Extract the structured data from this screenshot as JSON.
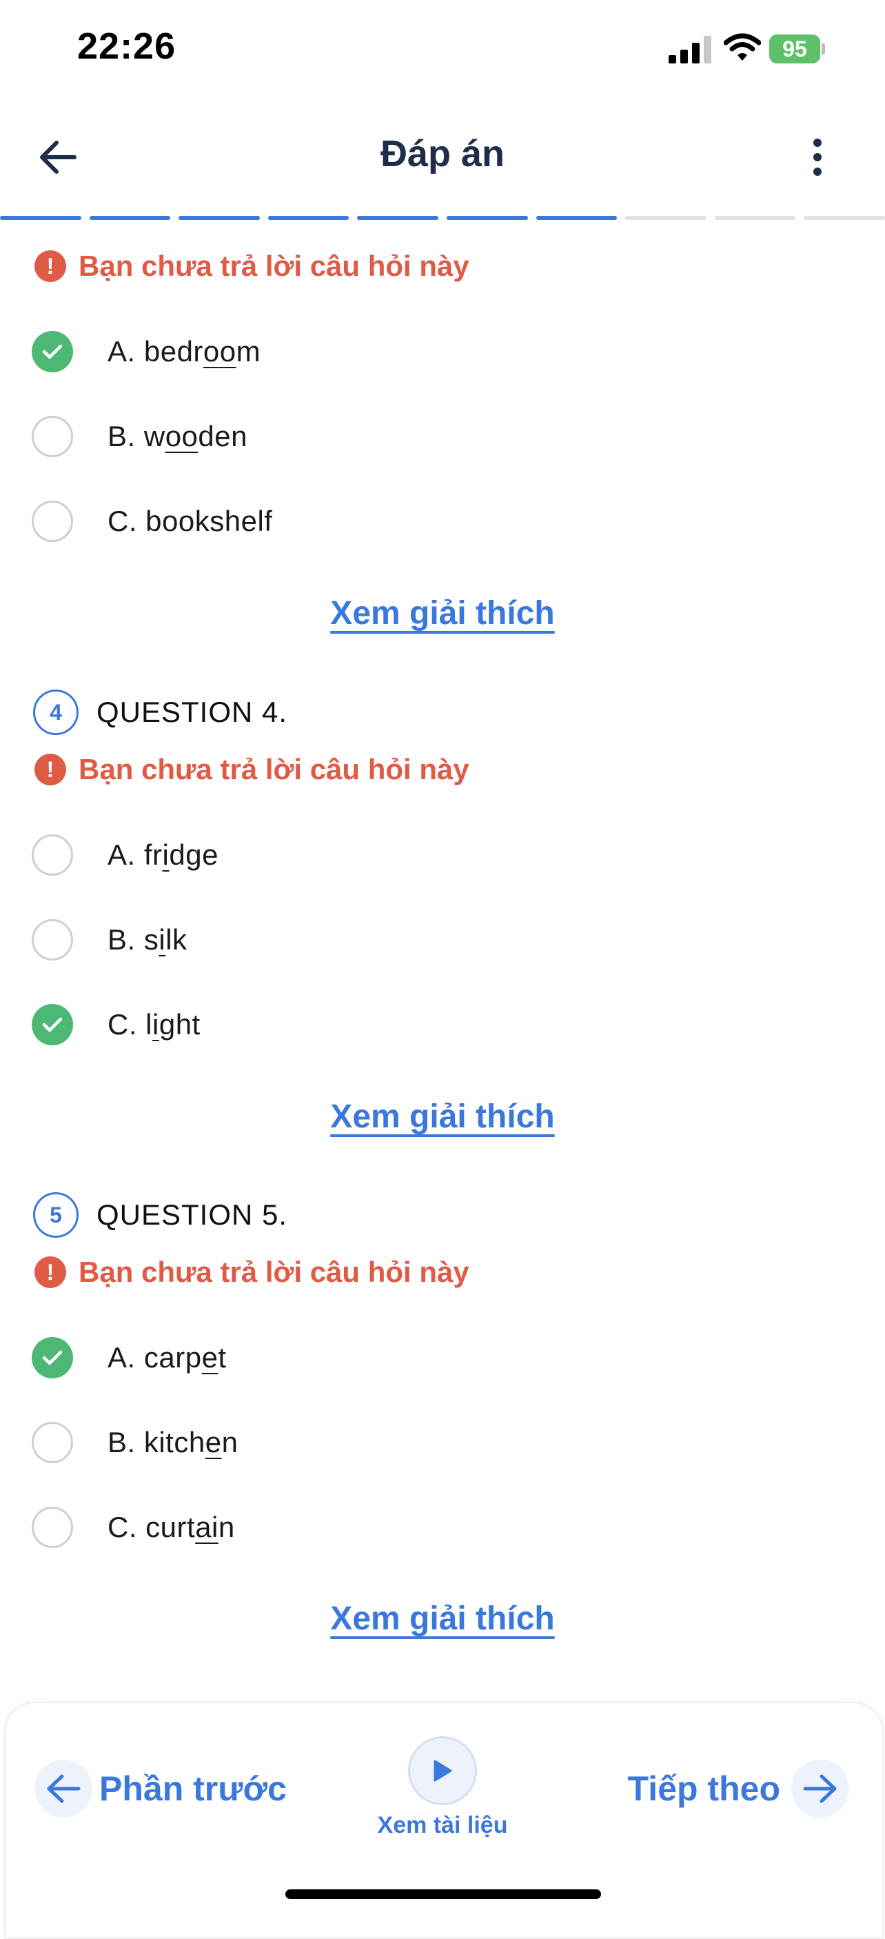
{
  "status": {
    "time": "22:26",
    "battery": "95"
  },
  "header": {
    "title": "Đáp án"
  },
  "progress": {
    "total": 10,
    "completed": 7
  },
  "warning_text": "Bạn chưa trả lời câu hỏi này",
  "explain_label": "Xem giải thích",
  "questions": [
    {
      "number": "",
      "title": "",
      "options": [
        {
          "label": "A. bedroom",
          "parts": [
            "A. bedr",
            "oo",
            "m"
          ],
          "correct": true
        },
        {
          "label": "B. wooden",
          "parts": [
            "B. w",
            "oo",
            "den"
          ],
          "correct": false
        },
        {
          "label": "C. bookshelf",
          "parts": [
            "C. bookshelf",
            "",
            ""
          ],
          "correct": false
        }
      ]
    },
    {
      "number": "4",
      "title": "QUESTION 4.",
      "options": [
        {
          "label": "A. fridge",
          "parts": [
            "A. fr",
            "i",
            "dge"
          ],
          "correct": false
        },
        {
          "label": "B. silk",
          "parts": [
            "B. s",
            "i",
            "lk"
          ],
          "correct": false
        },
        {
          "label": "C. light",
          "parts": [
            "C. l",
            "i",
            "ght"
          ],
          "correct": true
        }
      ]
    },
    {
      "number": "5",
      "title": "QUESTION 5.",
      "options": [
        {
          "label": "A. carpet",
          "parts": [
            "A. carp",
            "e",
            "t"
          ],
          "correct": true
        },
        {
          "label": "B. kitchen",
          "parts": [
            "B. kitch",
            "e",
            "n"
          ],
          "correct": false
        },
        {
          "label": "C. curtain",
          "parts": [
            "C. curt",
            "ai",
            "n"
          ],
          "correct": false
        }
      ]
    }
  ],
  "bottom": {
    "prev_label": "Phần trước",
    "play_label": "Xem tài liệu",
    "next_label": "Tiếp theo"
  },
  "icons": {
    "back": "arrow-left-icon",
    "more": "more-vertical-icon",
    "warning": "exclamation-icon",
    "check": "check-icon",
    "play": "play-icon"
  },
  "colors": {
    "accent": "#3b78dc",
    "warning": "#df5b46",
    "correct": "#4cb874",
    "battery": "#5ec16a"
  }
}
